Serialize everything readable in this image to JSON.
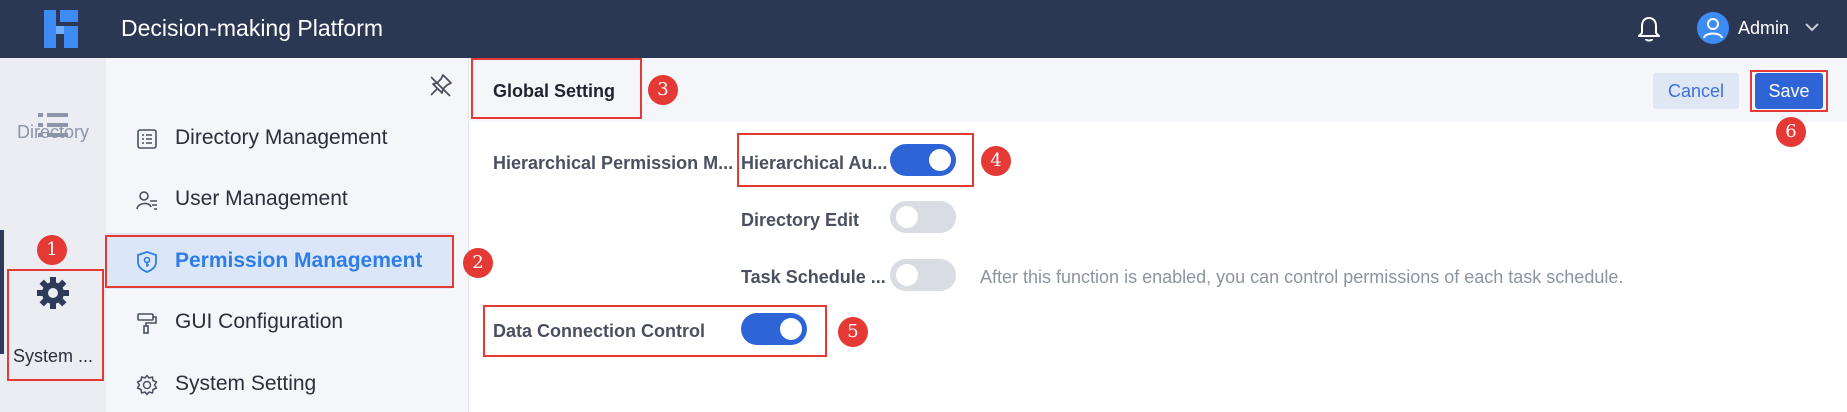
{
  "header": {
    "app_title": "Decision-making Platform",
    "user_name": "Admin",
    "icons": {
      "logo": "fr-logo",
      "bell": "bell-icon",
      "avatar": "user-avatar-icon",
      "chevron": "chevron-down-icon"
    },
    "colors": {
      "bar": "#2b3753",
      "logo": "#3d8cf5"
    }
  },
  "rail": {
    "items": [
      {
        "label": "Directory",
        "icon": "list-icon",
        "active": false
      },
      {
        "label": "System ...",
        "icon": "gear-icon",
        "active": true
      }
    ]
  },
  "submenu": {
    "pin_icon": "unpin-icon",
    "items": [
      {
        "label": "Directory Management",
        "icon": "list-doc-icon",
        "active": false
      },
      {
        "label": "User Management",
        "icon": "user-list-icon",
        "active": false
      },
      {
        "label": "Permission Management",
        "icon": "shield-key-icon",
        "active": true
      },
      {
        "label": "GUI Configuration",
        "icon": "paint-roller-icon",
        "active": false
      },
      {
        "label": "System Setting",
        "icon": "gear-outline-icon",
        "active": false
      }
    ]
  },
  "main": {
    "tab_label": "Global Setting",
    "cancel_label": "Cancel",
    "save_label": "Save",
    "settings": {
      "hierarchical_section_label": "Hierarchical Permission M...",
      "hierarchical_auth_label": "Hierarchical Au...",
      "hierarchical_auth_on": true,
      "directory_edit_label": "Directory Edit",
      "directory_edit_on": false,
      "task_schedule_label": "Task Schedule ...",
      "task_schedule_on": false,
      "task_schedule_desc": "After this function is enabled, you can control permissions of each task schedule.",
      "data_connection_label": "Data Connection Control",
      "data_connection_on": true
    },
    "colors": {
      "primary": "#2f64d6",
      "active_menu": "#2f7de6",
      "toggle_off": "#d9dce2"
    }
  },
  "annotations": {
    "markers": [
      "1",
      "2",
      "3",
      "4",
      "5",
      "6"
    ],
    "color": "#e53935"
  }
}
